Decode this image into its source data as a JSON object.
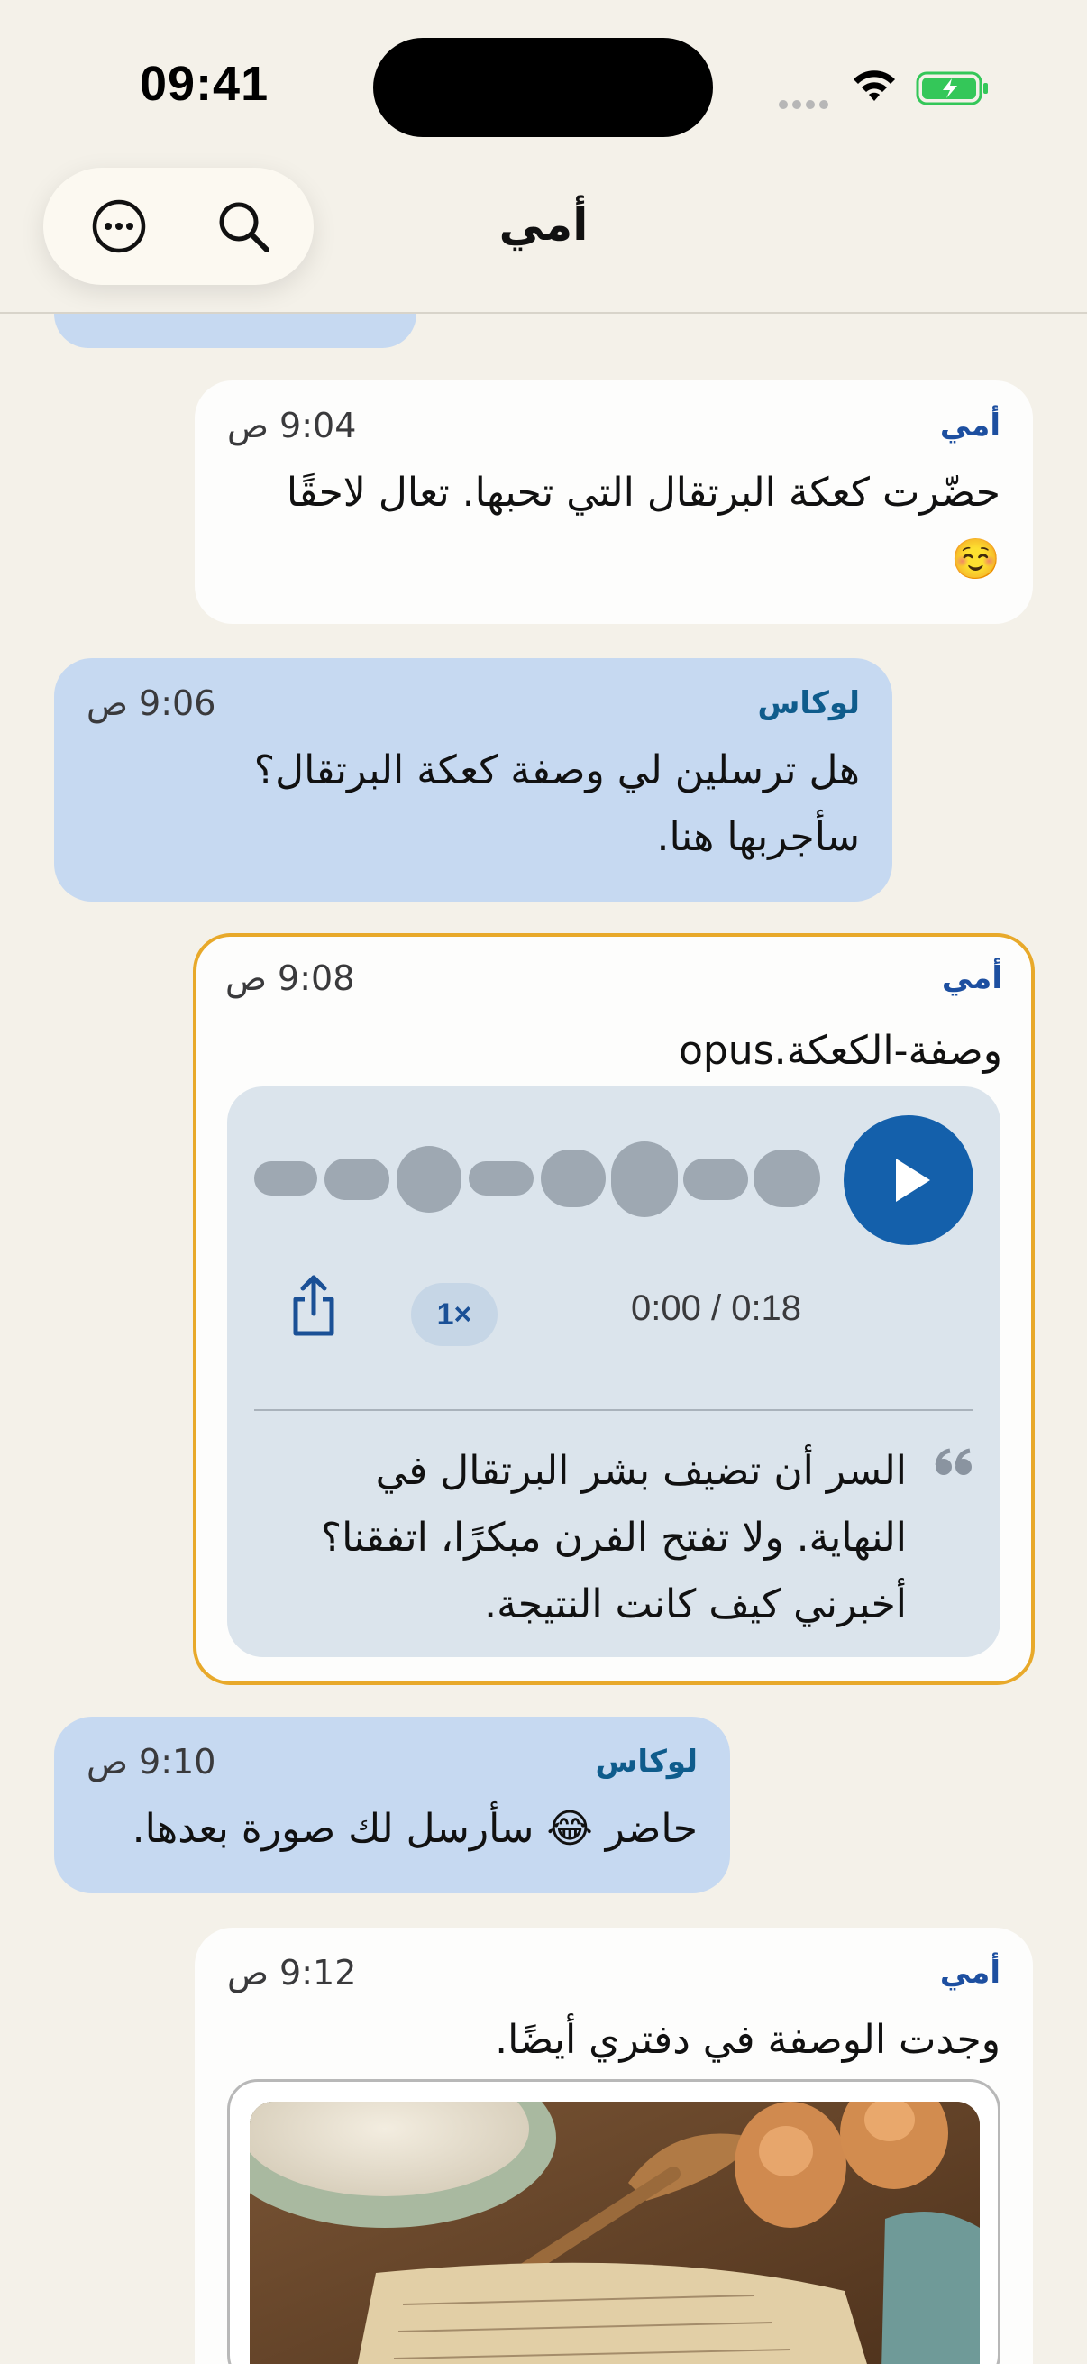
{
  "status": {
    "time": "09:41"
  },
  "header": {
    "title": "أمي"
  },
  "messages": [
    {
      "sender": "أمي",
      "time": "9:04 ص",
      "lines": [
        "حضّرت كعكة البرتقال التي تحبها. تعال لاحقًا",
        "☺️"
      ]
    },
    {
      "sender": "لوكاس",
      "time": "9:06 ص",
      "lines": [
        "هل ترسلين لي وصفة كعكة البرتقال؟",
        "سأجربها هنا."
      ]
    },
    {
      "sender": "أمي",
      "time": "9:08 ص",
      "filename": "وصفة-الكعكة.opus",
      "voice": {
        "duration": "0:00 / 0:18",
        "speed": "1×",
        "transcript": [
          "السر أن تضيف بشر البرتقال في",
          "النهاية. ولا تفتح الفرن مبكرًا، اتفقنا؟",
          "أخبرني كيف كانت النتيجة."
        ]
      }
    },
    {
      "sender": "لوكاس",
      "time": "9:10 ص",
      "lines": [
        "حاضر 😂 سأرسل لك صورة بعدها."
      ]
    },
    {
      "sender": "أمي",
      "time": "9:12 ص",
      "lines": [
        "وجدت الوصفة في دفتري أيضًا."
      ]
    }
  ],
  "colors": {
    "accent": "#1460ab",
    "highlight_border": "#e8a92a",
    "outgoing_bubble": "#c6d9f1",
    "incoming_bubble": "#fdfdfc",
    "background": "#f4f1e9"
  },
  "icons": {
    "more": "ellipsis-circle-icon",
    "search": "search-icon",
    "share": "share-icon",
    "quote": "quote-icon",
    "play": "play-icon"
  }
}
